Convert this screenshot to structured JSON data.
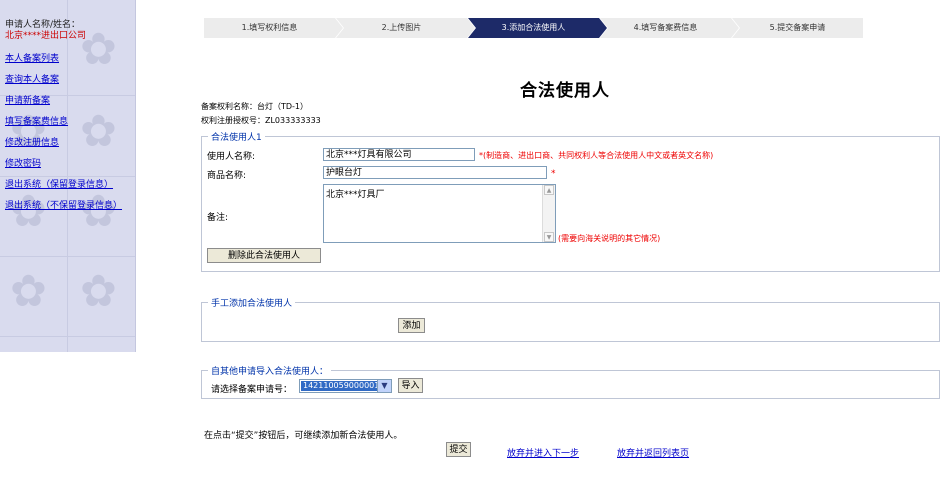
{
  "sidebar": {
    "applicant_label": "申请人名称/姓名：",
    "applicant_name": "北京****进出口公司",
    "links": [
      "本人备案列表",
      "查询本人备案",
      "申请新备案",
      "填写备案费信息",
      "修改注册信息",
      "修改密码",
      "退出系统（保留登录信息）",
      "退出系统（不保留登录信息）"
    ]
  },
  "steps": [
    {
      "label": "1.填写权利信息",
      "active": false
    },
    {
      "label": "2.上传图片",
      "active": false
    },
    {
      "label": "3.添加合法使用人",
      "active": true
    },
    {
      "label": "4.填写备案费信息",
      "active": false
    },
    {
      "label": "5.提交备案申请",
      "active": false
    }
  ],
  "page_title": "合法使用人",
  "info": {
    "right_name": "备案权利名称：台灯（TD-1）",
    "reg_no": "权利注册授权号：ZL033333333"
  },
  "user_section": {
    "legend": "合法使用人1",
    "user_name_label": "使用人名称:",
    "user_name_value": "北京***灯具有限公司",
    "user_name_hint": "*(制造商、进出口商、共同权利人等合法使用人中文或者英文名称)",
    "product_label": "商品名称:",
    "product_value": "护眼台灯",
    "product_req": "*",
    "remark_label": "备注:",
    "remark_value": "北京***灯具厂",
    "remark_hint": "(需要向海关说明的其它情况)",
    "delete_button": "删除此合法使用人"
  },
  "manual_section": {
    "legend": "手工添加合法使用人",
    "add_button": "添加"
  },
  "import_section": {
    "legend": "自其他申请导入合法使用人：",
    "select_label": "请选择备案申请号：",
    "select_value": "142110059000001",
    "import_button": "导入"
  },
  "footer": {
    "note": "在点击“提交”按钮后，可继续添加新合法使用人。",
    "submit_button": "提交",
    "next_link": "放弃并进入下一步",
    "back_link": "放弃并返回列表页"
  },
  "colors": {
    "sidebar_bg": "#d9dbee",
    "active_step": "#1d2a68",
    "link": "#0000cc",
    "required": "#ee0000"
  }
}
